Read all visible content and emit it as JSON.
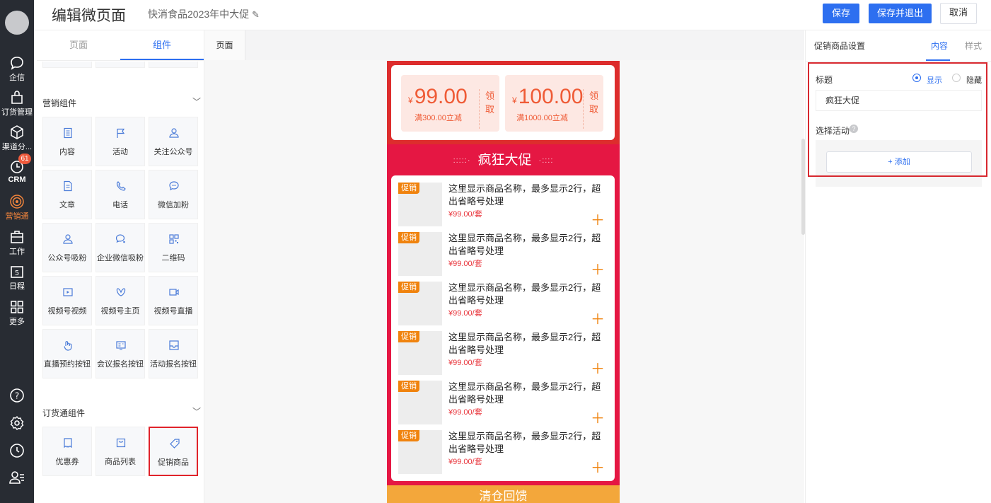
{
  "header": {
    "title": "编辑微页面",
    "subtitle": "快消食品2023年中大促",
    "save": "保存",
    "save_exit": "保存并退出",
    "cancel": "取消"
  },
  "sidebar": {
    "items": [
      {
        "label": "企信",
        "icon": "chat-bubble-icon"
      },
      {
        "label": "订货管理",
        "icon": "shopping-bag-icon"
      },
      {
        "label": "渠道分...",
        "icon": "cube-icon"
      },
      {
        "label": "CRM",
        "icon": "clock-icon",
        "badge": "61"
      },
      {
        "label": "营销通",
        "icon": "broadcast-icon",
        "active": true
      },
      {
        "label": "工作",
        "icon": "briefcase-icon"
      },
      {
        "label": "日程",
        "icon": "calendar-icon",
        "day": "5"
      },
      {
        "label": "更多",
        "icon": "grid-icon"
      }
    ],
    "bottom_icons": [
      "help-icon",
      "settings-icon",
      "history-icon",
      "contacts-icon"
    ]
  },
  "left_panel": {
    "tabs": [
      "页面",
      "组件"
    ],
    "active_tab": "组件",
    "marketing_section": "营销组件",
    "marketing_components": [
      {
        "label": "内容",
        "icon": "content-icon"
      },
      {
        "label": "活动",
        "icon": "flag-icon"
      },
      {
        "label": "关注公众号",
        "icon": "user-follow-icon"
      },
      {
        "label": "文章",
        "icon": "article-icon"
      },
      {
        "label": "电话",
        "icon": "phone-icon"
      },
      {
        "label": "微信加粉",
        "icon": "wechat-icon"
      },
      {
        "label": "公众号吸粉",
        "icon": "user-icon"
      },
      {
        "label": "企业微信吸粉",
        "icon": "enterprise-wechat-icon"
      },
      {
        "label": "二维码",
        "icon": "qrcode-icon"
      },
      {
        "label": "视频号视频",
        "icon": "video-icon"
      },
      {
        "label": "视频号主页",
        "icon": "butterfly-icon"
      },
      {
        "label": "视频号直播",
        "icon": "live-icon"
      },
      {
        "label": "直播预约按钮",
        "icon": "live-reserve-icon"
      },
      {
        "label": "会议报名按钮",
        "icon": "meeting-icon"
      },
      {
        "label": "活动报名按钮",
        "icon": "signup-icon"
      }
    ],
    "order_section": "订货通组件",
    "order_components": [
      {
        "label": "优惠券",
        "icon": "coupon-icon"
      },
      {
        "label": "商品列表",
        "icon": "product-list-icon"
      },
      {
        "label": "促销商品",
        "icon": "tag-icon",
        "selected": true
      }
    ]
  },
  "center": {
    "tab": "页面",
    "coupons": [
      {
        "value": "99.00",
        "currency": "¥",
        "condition": "满300.00立减",
        "claim": "领取"
      },
      {
        "value": "100.00",
        "currency": "¥",
        "condition": "满1000.00立减",
        "claim": "领取"
      }
    ],
    "promo_title": "疯狂大促",
    "products": [
      {
        "tag": "促销",
        "name": "这里显示商品名称，最多显示2行，超出省略号处理",
        "price": "¥99.00/套"
      },
      {
        "tag": "促销",
        "name": "这里显示商品名称，最多显示2行，超出省略号处理",
        "price": "¥99.00/套"
      },
      {
        "tag": "促销",
        "name": "这里显示商品名称，最多显示2行，超出省略号处理",
        "price": "¥99.00/套"
      },
      {
        "tag": "促销",
        "name": "这里显示商品名称，最多显示2行，超出省略号处理",
        "price": "¥99.00/套"
      },
      {
        "tag": "促销",
        "name": "这里显示商品名称，最多显示2行，超出省略号处理",
        "price": "¥99.00/套"
      },
      {
        "tag": "促销",
        "name": "这里显示商品名称，最多显示2行，超出省略号处理",
        "price": "¥99.00/套"
      }
    ],
    "next_title": "清仓回馈"
  },
  "right_panel": {
    "title": "促销商品设置",
    "tabs": [
      "内容",
      "样式"
    ],
    "active_tab": "内容",
    "title_label": "标题",
    "show": "显示",
    "hide": "隐藏",
    "title_value": "疯狂大促",
    "activity_label": "选择活动",
    "add_button": "+ 添加"
  },
  "colors": {
    "primary": "#2d6ff0",
    "promo_red": "#e51743",
    "accent_orange": "#f0830e",
    "highlight": "#e0232b"
  }
}
